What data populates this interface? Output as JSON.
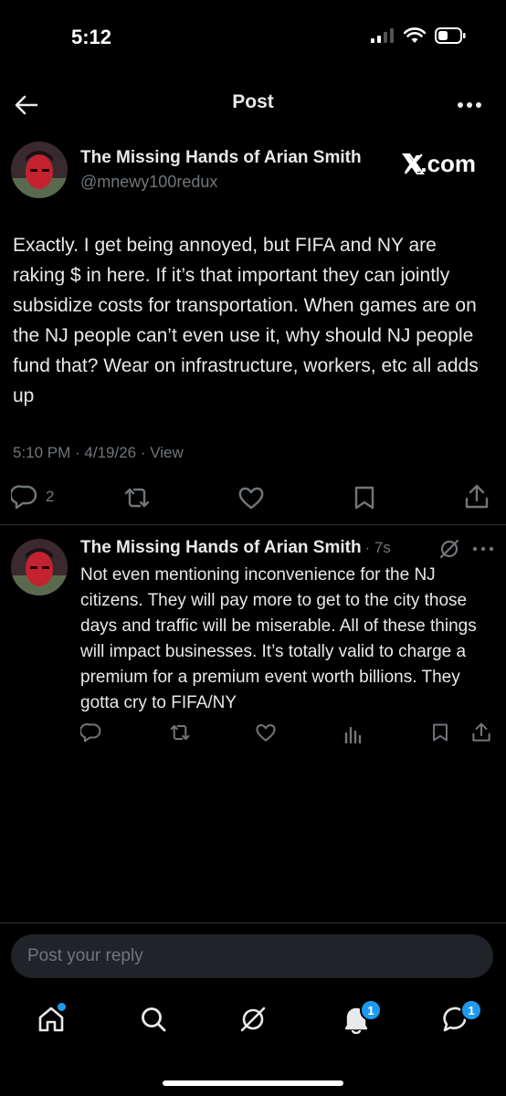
{
  "status_bar": {
    "time": "5:12"
  },
  "header": {
    "title": "Post"
  },
  "post": {
    "author_name": "The Missing Hands of Arian Smith",
    "author_handle": "@mnewy100redux",
    "watermark": "X.com",
    "text": "Exactly. I get being annoyed, but FIFA and NY are raking $ in here. If it’s that important they can jointly subsidize costs for transportation. When games are on the NJ people can’t even use it, why should NJ people fund that? Wear on infrastructure, workers, etc all adds up",
    "meta": "5:10 PM · 4/19/26 · View",
    "reply_count": "2"
  },
  "reply": {
    "author_name": "The Missing Hands of Arian Smith",
    "time": "· 7s",
    "text": "Not even mentioning inconvenience for the NJ citizens. They will pay more to get to the city those days and traffic will be miserable. All of these things will impact businesses. It’s totally valid to charge a premium for a premium event worth billions. They gotta cry to FIFA/NY"
  },
  "composer": {
    "placeholder": "Post your reply"
  },
  "tab_bar": {
    "notifications_badge": "1",
    "messages_badge": "1"
  },
  "colors": {
    "accent": "#1d9bf0",
    "muted": "#71767b",
    "background": "#000000"
  },
  "icons": [
    "back-arrow-icon",
    "more-icon",
    "reply-icon",
    "repost-icon",
    "like-icon",
    "bookmark-icon",
    "share-icon",
    "grok-icon",
    "views-icon",
    "home-icon",
    "search-icon",
    "bell-icon",
    "messages-icon"
  ]
}
